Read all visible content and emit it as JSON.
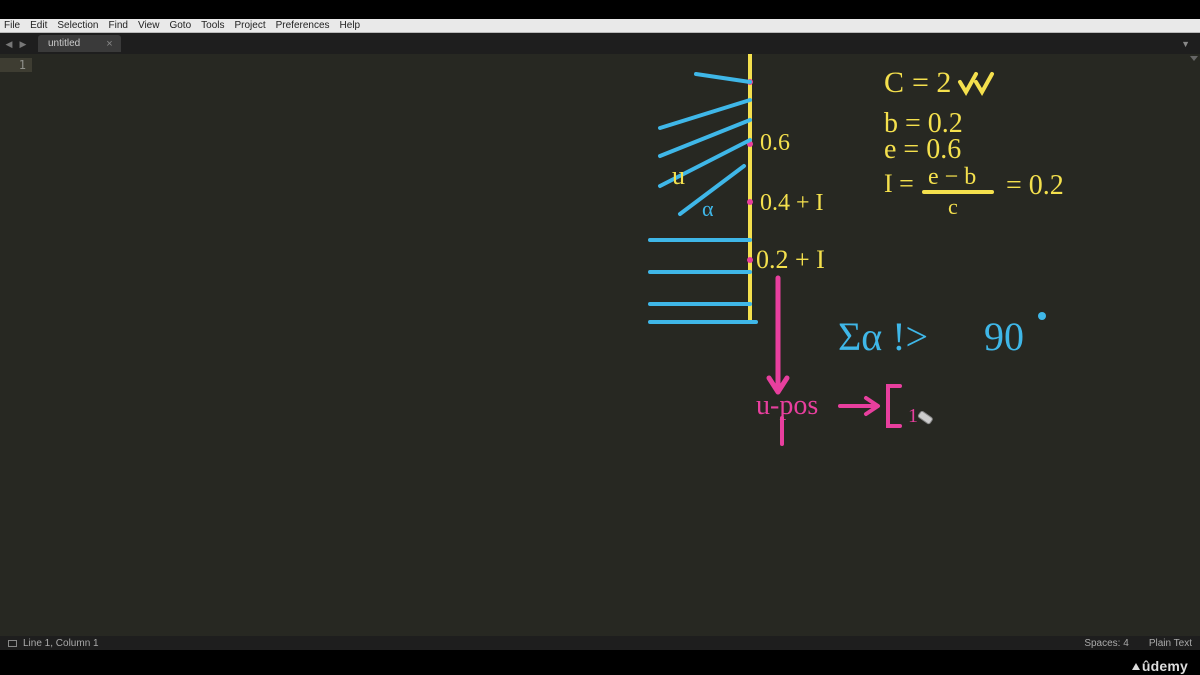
{
  "menu": [
    "File",
    "Edit",
    "Selection",
    "Find",
    "View",
    "Goto",
    "Tools",
    "Project",
    "Preferences",
    "Help"
  ],
  "tab": {
    "title": "untitled",
    "close": "×"
  },
  "gutter": {
    "line1": "1"
  },
  "status": {
    "pos": "Line 1, Column 1",
    "spaces": "Spaces: 4",
    "syntax": "Plain Text"
  },
  "watermark": "ûdemy",
  "annotations": {
    "yellow": {
      "c_label": "C",
      "c_eq": "= 2",
      "b": "b = 0.2",
      "e": "e = 0.6",
      "I_lhs": "I =",
      "I_num": "e − b",
      "I_den": "c",
      "I_res": "= 0.2",
      "tick06": "0.6",
      "tick04": "0.4 + I",
      "tick02": "0.2 + I",
      "u": "u",
      "alpha": "α"
    },
    "cyan": {
      "sum": "Σα !>",
      "ninety": "90",
      "deg": "°"
    },
    "magenta": {
      "upos": "u-pos",
      "bracket": "[₁"
    }
  }
}
